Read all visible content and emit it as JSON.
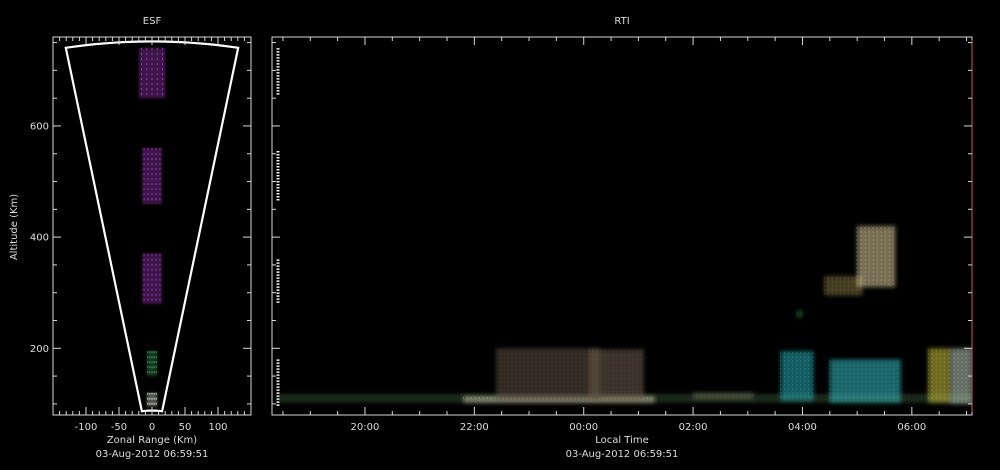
{
  "colors": {
    "background": "#000000",
    "axes": "#d8d8d8",
    "text": "#dcdcdc",
    "fan_outline": "#ffffff"
  },
  "chart_data": [
    {
      "type": "heatmap",
      "title": "ESF",
      "xlabel": "Zonal Range (Km)",
      "ylabel": "Altitude (Km)",
      "footer": "03-Aug-2012 06:59:51",
      "xlim": [
        -150,
        150
      ],
      "ylim": [
        80,
        760
      ],
      "xticks": [
        -100,
        -50,
        0,
        50,
        100
      ],
      "xticklabels": [
        "-100",
        "-50",
        "0",
        "50",
        "100"
      ],
      "yticks": [
        200,
        400,
        600
      ],
      "yticklabels": [
        "200",
        "400",
        "600"
      ],
      "fan": {
        "half_angle_deg": 10,
        "range_min_km": 88,
        "range_max_km": 752
      },
      "echoes": [
        {
          "x": [
            -20,
            20
          ],
          "y": [
            650,
            740
          ],
          "color": "#b040d0",
          "label": ""
        },
        {
          "x": [
            -15,
            15
          ],
          "y": [
            460,
            560
          ],
          "color": "#b040d0",
          "label": ""
        },
        {
          "x": [
            -15,
            15
          ],
          "y": [
            280,
            370
          ],
          "color": "#b040d0",
          "label": ""
        },
        {
          "x": [
            -8,
            8
          ],
          "y": [
            150,
            195
          ],
          "color": "#40a060",
          "label": ""
        },
        {
          "x": [
            -8,
            8
          ],
          "y": [
            95,
            120
          ],
          "color": "#e8f0e0",
          "label": ""
        }
      ]
    },
    {
      "type": "heatmap",
      "title": "RTI",
      "xlabel": "Local Time",
      "footer": "03-Aug-2012 06:59:51",
      "xlim": [
        18.3,
        31.1
      ],
      "ylim": [
        80,
        760
      ],
      "xticks": [
        20,
        22,
        24,
        26,
        28,
        30
      ],
      "xticklabels": [
        "20:00",
        "22:00",
        "00:00",
        "02:00",
        "04:00",
        "06:00"
      ],
      "yticks": [
        200,
        400,
        600
      ],
      "echoes": [
        {
          "x": [
            18.4,
            31.1
          ],
          "y": [
            102,
            118
          ],
          "color": "#2f4a2f",
          "label": ""
        },
        {
          "x": [
            21.8,
            25.3
          ],
          "y": [
            102,
            114
          ],
          "color": "#cfc4a8",
          "label": ""
        },
        {
          "x": [
            22.4,
            24.3
          ],
          "y": [
            108,
            200
          ],
          "color": "#5a4e40",
          "label": ""
        },
        {
          "x": [
            24.1,
            25.1
          ],
          "y": [
            108,
            198
          ],
          "color": "#6a5a48",
          "label": ""
        },
        {
          "x": [
            26.0,
            27.1
          ],
          "y": [
            108,
            120
          ],
          "color": "#6a6e58",
          "label": ""
        },
        {
          "x": [
            27.6,
            28.2
          ],
          "y": [
            105,
            195
          ],
          "color": "#2aa8b0",
          "label": ""
        },
        {
          "x": [
            28.5,
            29.8
          ],
          "y": [
            102,
            180
          ],
          "color": "#30b8c0",
          "label": ""
        },
        {
          "x": [
            30.3,
            30.7
          ],
          "y": [
            102,
            200
          ],
          "color": "#c8c040",
          "label": ""
        },
        {
          "x": [
            30.7,
            31.1
          ],
          "y": [
            100,
            200
          ],
          "color": "#b8c8b8",
          "label": ""
        },
        {
          "x": [
            27.9,
            28.0
          ],
          "y": [
            255,
            268
          ],
          "color": "#3a7a40",
          "label": ""
        },
        {
          "x": [
            28.4,
            29.1
          ],
          "y": [
            295,
            330
          ],
          "color": "#7a6e40",
          "label": ""
        },
        {
          "x": [
            29.0,
            29.7
          ],
          "y": [
            310,
            420
          ],
          "color": "#d8c898",
          "label": ""
        }
      ],
      "range_markers": [
        [
          95,
          180
        ],
        [
          280,
          360
        ],
        [
          465,
          555
        ],
        [
          655,
          740
        ]
      ]
    }
  ]
}
